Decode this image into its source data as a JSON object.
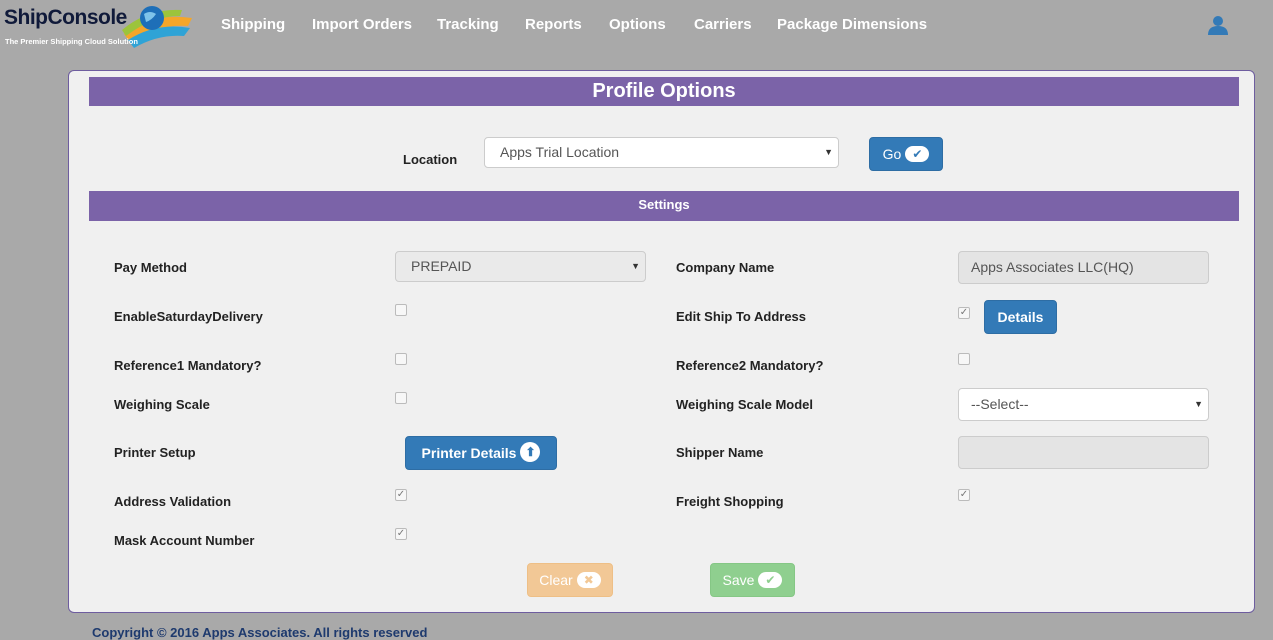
{
  "brand": {
    "name": "ShipConsole",
    "tagline": "The Premier Shipping Cloud Solution"
  },
  "nav": {
    "items": [
      "Shipping",
      "Import Orders",
      "Tracking",
      "Reports",
      "Options",
      "Carriers",
      "Package Dimensions"
    ]
  },
  "page": {
    "title": "Profile Options",
    "location_label": "Location",
    "location_value": "Apps Trial Location",
    "go_label": "Go",
    "settings_title": "Settings"
  },
  "fields": {
    "pay_method": {
      "label": "Pay Method",
      "value": "PREPAID"
    },
    "company_name": {
      "label": "Company Name",
      "value": "Apps Associates LLC(HQ)"
    },
    "saturday_delivery": {
      "label": "EnableSaturdayDelivery",
      "checked": false
    },
    "edit_ship_to": {
      "label": "Edit Ship To Address",
      "checked": true,
      "button": "Details"
    },
    "reference1": {
      "label": "Reference1 Mandatory?",
      "checked": false
    },
    "reference2": {
      "label": "Reference2 Mandatory?",
      "checked": false
    },
    "weighing_scale": {
      "label": "Weighing Scale",
      "checked": false
    },
    "weighing_scale_model": {
      "label": "Weighing Scale Model",
      "value": "--Select--"
    },
    "printer_setup": {
      "label": "Printer Setup",
      "button": "Printer Details"
    },
    "shipper_name": {
      "label": "Shipper Name",
      "value": ""
    },
    "address_validation": {
      "label": "Address Validation",
      "checked": true
    },
    "freight_shopping": {
      "label": "Freight Shopping",
      "checked": true
    },
    "mask_account": {
      "label": "Mask Account Number",
      "checked": true
    }
  },
  "actions": {
    "clear": "Clear",
    "save": "Save"
  },
  "footer": {
    "text": "Copyright © 2016 Apps Associates. All rights reserved"
  },
  "colors": {
    "header_bar": "#7b63a8",
    "primary": "#337ab7",
    "clear": "#f2c896",
    "save": "#8fcf8f",
    "background": "#a9a9a9"
  }
}
